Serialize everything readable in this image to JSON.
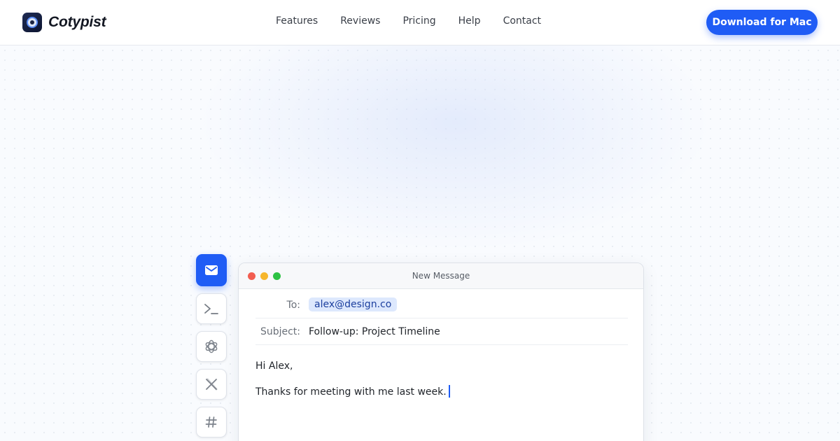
{
  "brand": {
    "name": "Cotypist"
  },
  "nav": {
    "items": [
      "Features",
      "Reviews",
      "Pricing",
      "Help",
      "Contact"
    ]
  },
  "cta": {
    "label": "Download for Mac"
  },
  "colors": {
    "accent": "#1f5cf5",
    "chip_bg": "#dde8fd"
  },
  "dock": {
    "items": [
      {
        "icon": "mail-icon",
        "active": true
      },
      {
        "icon": "terminal-icon",
        "active": false
      },
      {
        "icon": "openai-icon",
        "active": false
      },
      {
        "icon": "x-logo-icon",
        "active": false
      },
      {
        "icon": "hashtag-icon",
        "active": false
      }
    ]
  },
  "compose": {
    "window_title": "New Message",
    "to_label": "To:",
    "to_value": "alex@design.co",
    "subject_label": "Subject:",
    "subject_value": "Follow-up: Project Timeline",
    "body_line1": "Hi Alex,",
    "body_line2": "Thanks for meeting with me last week."
  }
}
